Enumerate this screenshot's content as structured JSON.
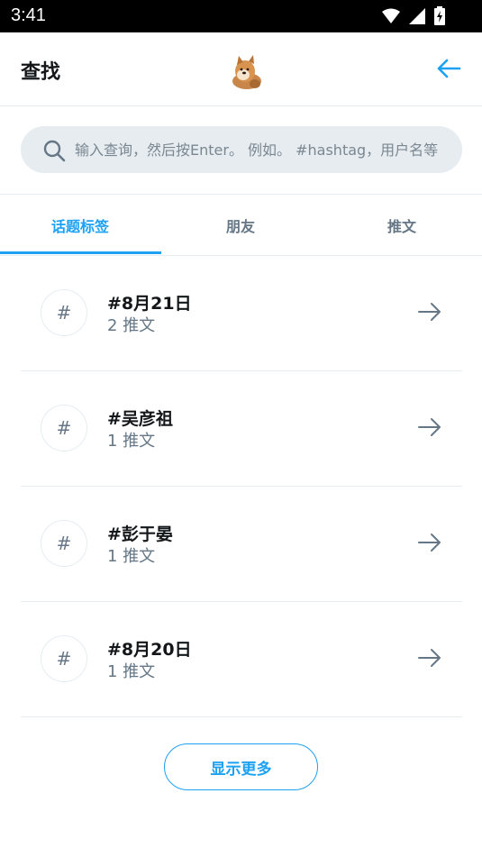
{
  "status_bar": {
    "time": "3:41",
    "icons": [
      "wifi-icon",
      "signal-icon",
      "battery-charging-icon"
    ]
  },
  "header": {
    "title": "查找",
    "avatar_icon": "shiba-dog-avatar",
    "back_icon": "arrow-left-icon"
  },
  "search": {
    "placeholder": "输入查询，然后按Enter。 例如。 #hashtag，用户名等",
    "value": ""
  },
  "tabs": [
    {
      "label": "话题标签",
      "active": true
    },
    {
      "label": "朋友",
      "active": false
    },
    {
      "label": "推文",
      "active": false
    }
  ],
  "hashtags": [
    {
      "icon": "#",
      "title": "#8月21日",
      "count": "2 推文"
    },
    {
      "icon": "#",
      "title": "#吴彦祖",
      "count": "1 推文"
    },
    {
      "icon": "#",
      "title": "#彭于晏",
      "count": "1 推文"
    },
    {
      "icon": "#",
      "title": "#8月20日",
      "count": "1 推文"
    }
  ],
  "show_more_label": "显示更多",
  "colors": {
    "accent": "#1da1f2",
    "muted_text": "#657786",
    "divider": "#e6ecf0",
    "search_bg": "#e6ecf0"
  }
}
